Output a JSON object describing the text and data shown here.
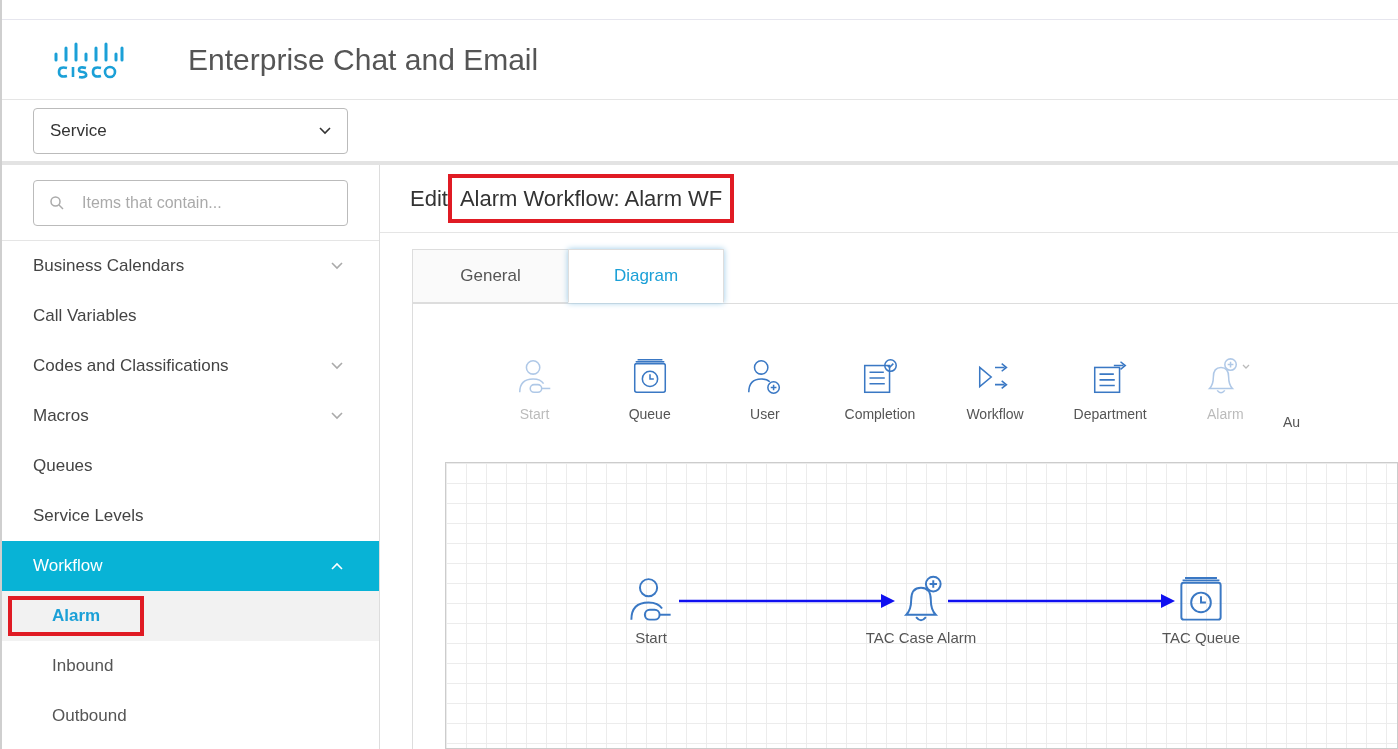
{
  "header": {
    "title": "Enterprise Chat and Email"
  },
  "department_select": {
    "value": "Service"
  },
  "sidebar": {
    "search": {
      "placeholder": "Items that contain..."
    },
    "items": [
      {
        "label": "Business Calendars",
        "expandable": true,
        "expanded": false,
        "selected": false
      },
      {
        "label": "Call Variables",
        "expandable": false,
        "selected": false
      },
      {
        "label": "Codes and Classifications",
        "expandable": true,
        "expanded": false,
        "selected": false
      },
      {
        "label": "Macros",
        "expandable": true,
        "expanded": false,
        "selected": false
      },
      {
        "label": "Queues",
        "expandable": false,
        "selected": false
      },
      {
        "label": "Service Levels",
        "expandable": false,
        "selected": false
      },
      {
        "label": "Workflow",
        "expandable": true,
        "expanded": true,
        "selected": true,
        "children": [
          {
            "label": "Alarm",
            "selected": true,
            "highlighted": true
          },
          {
            "label": "Inbound",
            "selected": false,
            "highlighted": false
          },
          {
            "label": "Outbound",
            "selected": false,
            "highlighted": false
          }
        ]
      }
    ]
  },
  "page": {
    "title_prefix": "Edit",
    "title": "Alarm Workflow: Alarm WF",
    "title_highlighted": true
  },
  "tabs": [
    {
      "label": "General",
      "selected": false
    },
    {
      "label": "Diagram",
      "selected": true
    }
  ],
  "toolbar": [
    {
      "kind": "start",
      "label": "Start",
      "disabled": true
    },
    {
      "kind": "queue",
      "label": "Queue",
      "disabled": false
    },
    {
      "kind": "user",
      "label": "User",
      "disabled": false
    },
    {
      "kind": "completion",
      "label": "Completion",
      "disabled": false
    },
    {
      "kind": "workflow",
      "label": "Workflow",
      "disabled": false
    },
    {
      "kind": "department",
      "label": "Department",
      "disabled": false
    },
    {
      "kind": "alarm",
      "label": "Alarm",
      "disabled": true
    },
    {
      "kind": "cut",
      "label": "Au",
      "disabled": false
    }
  ],
  "diagram": {
    "nodes": [
      {
        "kind": "start",
        "label": "Start"
      },
      {
        "kind": "alarm",
        "label": "TAC Case Alarm"
      },
      {
        "kind": "queue",
        "label": "TAC Queue"
      }
    ]
  }
}
